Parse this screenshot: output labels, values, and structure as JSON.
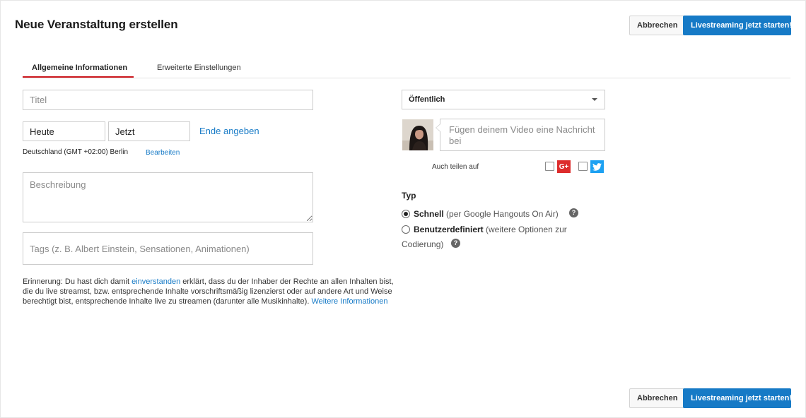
{
  "header": {
    "title": "Neue Veranstaltung erstellen",
    "cancel_label": "Abbrechen",
    "start_label": "Livestreaming jetzt starten!"
  },
  "tabs": [
    {
      "label": "Allgemeine Informationen",
      "active": true
    },
    {
      "label": "Erweiterte Einstellungen",
      "active": false
    }
  ],
  "form": {
    "title_placeholder": "Titel",
    "date_value": "Heute",
    "time_value": "Jetzt",
    "end_link": "Ende angeben",
    "timezone": "Deutschland (GMT +02:00) Berlin",
    "timezone_edit": "Bearbeiten",
    "description_placeholder": "Beschreibung",
    "tags_placeholder": "Tags (z. B. Albert Einstein, Sensationen, Animationen)"
  },
  "notice": {
    "part1": "Erinnerung: Du hast dich damit ",
    "link1": "einverstanden",
    "part2": " erklärt, dass du der Inhaber der Rechte an allen Inhalten bist, die du live streamst, bzw. entsprechende Inhalte vorschriftsmäßig lizenzierst oder auf andere Art und Weise berechtigt bist, entsprechende Inhalte live zu streamen (darunter alle Musikinhalte). ",
    "link2": "Weitere Informationen"
  },
  "privacy": {
    "selected": "Öffentlich"
  },
  "share": {
    "message_placeholder": "Fügen deinem Video eine Nachricht bei",
    "label": "Auch teilen auf",
    "gplus_icon_text": "G+",
    "twitter_icon": "twitter-bird-icon"
  },
  "type": {
    "label": "Typ",
    "options": [
      {
        "name": "Schnell",
        "detail": " (per Google Hangouts On Air)",
        "checked": true
      },
      {
        "name": "Benutzerdefiniert",
        "detail": " (weitere Optionen zur",
        "detail_cont": "Codierung)",
        "checked": false
      }
    ],
    "help_glyph": "?"
  },
  "colors": {
    "primary": "#167ac6",
    "tab_accent": "#cc181e",
    "gplus": "#dd2c2c",
    "twitter": "#1da1f2"
  }
}
